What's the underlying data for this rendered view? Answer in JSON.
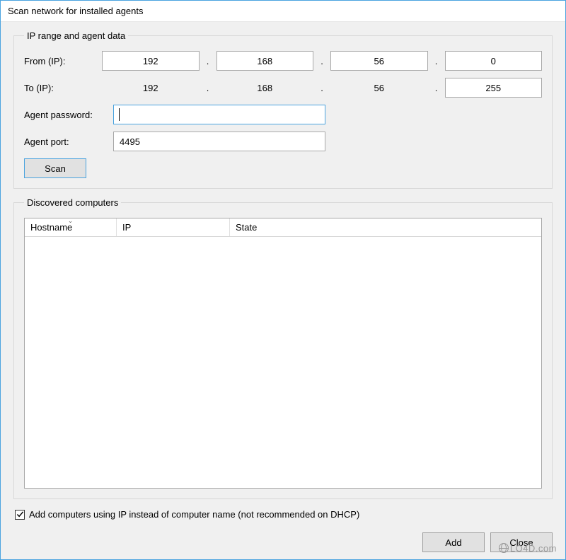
{
  "window": {
    "title": "Scan network for installed agents"
  },
  "groups": {
    "range_title": "IP range and agent data",
    "discovered_title": "Discovered computers"
  },
  "labels": {
    "from_ip": "From (IP):",
    "to_ip": "To (IP):",
    "agent_password": "Agent password:",
    "agent_port": "Agent port:"
  },
  "ip": {
    "from": {
      "a": "192",
      "b": "168",
      "c": "56",
      "d": "0"
    },
    "to": {
      "a": "192",
      "b": "168",
      "c": "56",
      "d": "255"
    },
    "dot": "."
  },
  "fields": {
    "agent_password": "",
    "agent_port": "4495"
  },
  "buttons": {
    "scan": "Scan",
    "add": "Add",
    "close": "Close"
  },
  "table": {
    "columns": {
      "hostname": "Hostname",
      "ip": "IP",
      "state": "State"
    },
    "sort_column": "hostname",
    "sort_dir": "asc",
    "rows": []
  },
  "checkbox": {
    "add_by_ip_label": "Add computers using IP instead of computer name (not recommended on DHCP)",
    "add_by_ip_checked": true
  },
  "watermark": "LO4D.com"
}
